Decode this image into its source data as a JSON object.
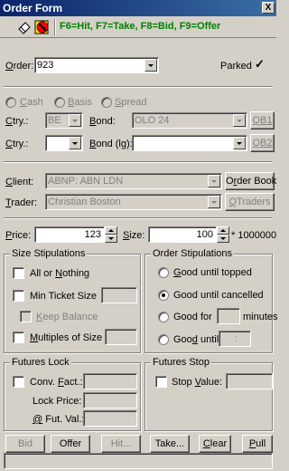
{
  "title": "Order Form",
  "close_glyph": "X",
  "toolbar": {
    "hint": "F6=Hit, F7=Take, F8=Bid, F9=Offer"
  },
  "order": {
    "label_u": "O",
    "label": "rder:",
    "value": "923",
    "parked_label": "Parked",
    "parked_checked": true
  },
  "order_type": {
    "options": [
      {
        "label": "Cash",
        "label_u": "C",
        "label_rest": "ash"
      },
      {
        "label": "Basis",
        "label_u": "B",
        "label_rest": "asis"
      },
      {
        "label": "Spread",
        "label_u": "S",
        "label_rest": "pread"
      }
    ]
  },
  "ctry1": {
    "label_u": "C",
    "label": "try.:",
    "value": "BE"
  },
  "bond": {
    "label_u": "B",
    "label": "ond:",
    "value": "OLO 24",
    "button": "QB1"
  },
  "ctry2": {
    "label_u": "C",
    "label": "try.:",
    "value": ""
  },
  "bond_lg": {
    "label_u": "B",
    "label": "ond (lg):",
    "value": "",
    "button": "QB2"
  },
  "client": {
    "label_u": "C",
    "label": "lient:",
    "value": "ABNP: ABN LDN",
    "button_u": "r",
    "button_pre": "O",
    "button_post": "der Book"
  },
  "trader": {
    "label_u": "T",
    "label": "rader:",
    "value": "Christian Boston",
    "button_u": "Q",
    "button_post": "Traders"
  },
  "price": {
    "label_u": "P",
    "label": "rice:",
    "value": "123"
  },
  "size": {
    "label_u": "S",
    "label": "ize:",
    "value": "100",
    "multiplier": "* 1000000"
  },
  "size_stipulations": {
    "title": "Size Stipulations",
    "all_or_nothing_pre": "All or ",
    "all_or_nothing_u": "N",
    "all_or_nothing_post": "othing",
    "min_ticket": "Min Ticket Size",
    "keep_balance_u": "K",
    "keep_balance_post": "eep Balance",
    "multiples_u": "M",
    "multiples_post": "ultiples of Size"
  },
  "order_stipulations": {
    "title": "Order Stipulations",
    "good_topped_u": "G",
    "good_topped_post": "ood until topped",
    "good_cancelled": "Good until cancelled",
    "good_for": "Good for",
    "minutes": "minutes",
    "good_until_pre": "Goo",
    "good_until_u": "d",
    "good_until_post": " until",
    "good_until_value": ":"
  },
  "futures_lock": {
    "title": "Futures Lock",
    "conv_fact_pre": "Conv. ",
    "conv_fact_u": "F",
    "conv_fact_post": "act.:",
    "lock_price": "Lock Price:",
    "fut_val_u": "@",
    "fut_val_post": " Fut. Val.:"
  },
  "futures_stop": {
    "title": "Futures Stop",
    "stop_value_pre": "Stop ",
    "stop_value_u": "V",
    "stop_value_post": "alue:"
  },
  "buttons": {
    "bid": "Bid",
    "offer": "Offer",
    "hit": "Hit...",
    "take": "Take...",
    "clear_u": "C",
    "clear_post": "lear",
    "pull_u": "P",
    "pull_post": "ull"
  },
  "colors": {
    "hint_green": "#008000",
    "title_blue": "#0a246a",
    "chrome": "#d4d0c8"
  }
}
